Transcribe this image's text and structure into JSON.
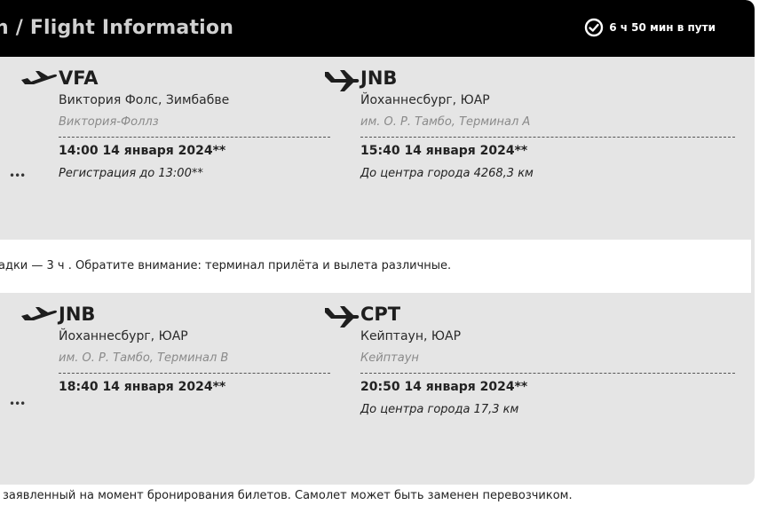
{
  "header": {
    "title": "n / Flight Information",
    "duration": "6 ч 50 мин в пути",
    "duration_icon": "clock-check-icon"
  },
  "segments": [
    {
      "departure": {
        "icon": "plane-takeoff-icon",
        "code": "VFA",
        "city": "Виктория Фолс, Зимбабве",
        "airport": "Виктория-Фоллз",
        "time": "14:00 14 января 2024**",
        "note": "Регистрация до 13:00**"
      },
      "arrival": {
        "icon": "plane-landing-icon",
        "code": "JNB",
        "city": "Йоханнесбург, ЮАР",
        "airport": "им. О. Р. Тамбо, Терминал A",
        "time": "15:40 14 января 2024**",
        "note": "До центра города 4268,3 км"
      },
      "more": "•••"
    },
    {
      "departure": {
        "icon": "plane-takeoff-icon",
        "code": "JNB",
        "city": "Йоханнесбург, ЮАР",
        "airport": "им. О. Р. Тамбо, Терминал B",
        "time": "18:40 14 января 2024**"
      },
      "arrival": {
        "icon": "plane-landing-icon",
        "code": "CPT",
        "city": "Кейптаун, ЮАР",
        "airport": "Кейптаун",
        "time": "20:50 14 января 2024**",
        "note": "До центра города 17,3 км"
      },
      "more": "•••"
    }
  ],
  "transfer_text": "адки — 3 ч . Обратите внимание: терминал прилёта и вылета различные.",
  "footnote": "заявленный на момент бронирования билетов. Самолет может быть заменен перевозчиком.",
  "colors": {
    "header_bg": "#000000",
    "card_bg": "#e5e5e5",
    "transfer_bg": "#ffffff"
  }
}
